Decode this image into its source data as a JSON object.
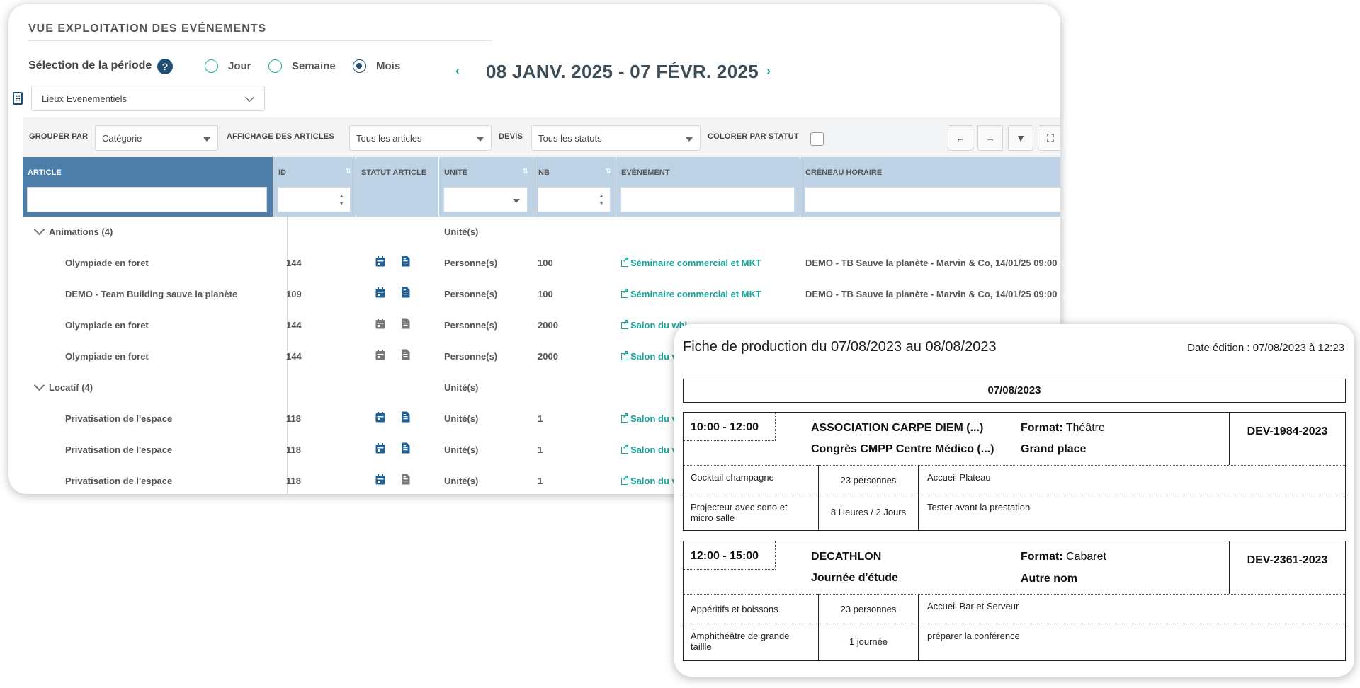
{
  "header": {
    "title": "VUE EXPLOITATION DES EVÉNEMENTS",
    "period_label": "Sélection de la période",
    "help_symbol": "?",
    "period_options": [
      "Jour",
      "Semaine",
      "Mois"
    ],
    "selected_period": "Mois",
    "date_range": "08 JANV. 2025 - 07 FÉVR. 2025",
    "venue": "Lieux Evenementiels"
  },
  "toolbar": {
    "group_by_label": "GROUPER PAR",
    "group_by_value": "Catégorie",
    "display_label": "AFFICHAGE DES ARTICLES",
    "display_value": "Tous les articles",
    "quote_label": "DEVIS",
    "quote_value": "Tous les statuts",
    "color_by_status_label": "COLORER PAR STATUT",
    "color_by_status_checked": false,
    "buttons": [
      "arrow-left-icon",
      "arrow-right-icon",
      "filter-icon",
      "fullscreen-icon"
    ]
  },
  "grid": {
    "columns": [
      "ARTICLE",
      "ID",
      "STATUT ARTICLE",
      "UNITÉ",
      "NB",
      "EVÉNEMENT",
      "CRÉNEAU HORAIRE"
    ],
    "groups": [
      {
        "name": "Animations (4)",
        "unit": "Unité(s)",
        "rows": [
          {
            "article": "Olympiade en foret",
            "id": "144",
            "status": "active",
            "unit": "Personne(s)",
            "nb": "100",
            "event": "Séminaire commercial et MKT",
            "slot": "DEMO - TB Sauve la planète - Marvin & Co, 14/01/25 09:00 -"
          },
          {
            "article": "DEMO - Team Building sauve la planète",
            "id": "109",
            "status": "active",
            "unit": "Personne(s)",
            "nb": "100",
            "event": "Séminaire commercial et MKT",
            "slot": "DEMO - TB Sauve la planète - Marvin & Co, 14/01/25 09:00 -"
          },
          {
            "article": "Olympiade en foret",
            "id": "144",
            "status": "inactive",
            "unit": "Personne(s)",
            "nb": "2000",
            "event": "Salon du whi",
            "slot": ""
          },
          {
            "article": "Olympiade en foret",
            "id": "144",
            "status": "inactive",
            "unit": "Personne(s)",
            "nb": "2000",
            "event": "Salon du v",
            "slot": ""
          }
        ]
      },
      {
        "name": "Locatif (4)",
        "unit": "Unité(s)",
        "rows": [
          {
            "article": "Privatisation de l'espace",
            "id": "118",
            "status": "active",
            "unit": "Unité(s)",
            "nb": "1",
            "event": "Salon du v",
            "slot": ""
          },
          {
            "article": "Privatisation de l'espace",
            "id": "118",
            "status": "active",
            "unit": "Unité(s)",
            "nb": "1",
            "event": "Salon du v",
            "slot": ""
          },
          {
            "article": "Privatisation de l'espace",
            "id": "118",
            "status": "mixed",
            "unit": "Unité(s)",
            "nb": "1",
            "event": "Salon du v",
            "slot": ""
          }
        ]
      }
    ]
  },
  "production_sheet": {
    "title": "Fiche de production du 07/08/2023 au 08/08/2023",
    "edition": "Date édition : 07/08/2023 à 12:23",
    "day": "07/08/2023",
    "bookings": [
      {
        "time": "10:00 - 12:00",
        "client": "ASSOCIATION CARPE DIEM (...)",
        "event": "Congrès CMPP Centre Médico (...)",
        "format_label": "Format:",
        "format_value": "Théâtre",
        "room": "Grand place",
        "ref": "DEV-1984-2023",
        "items": [
          {
            "name": "Cocktail champagne",
            "qty": "23 personnes",
            "note": "Accueil Plateau"
          },
          {
            "name": "Projecteur avec sono et micro salle",
            "qty": "8 Heures / 2 Jours",
            "note": "Tester avant la prestation"
          }
        ]
      },
      {
        "time": "12:00 - 15:00",
        "client": "DECATHLON",
        "event": "Journée d'étude",
        "format_label": "Format:",
        "format_value": "Cabaret",
        "room": "Autre nom",
        "ref": "DEV-2361-2023",
        "items": [
          {
            "name": "Appéritifs et boissons",
            "qty": "23 personnes",
            "note": "Accueil Bar et Serveur"
          },
          {
            "name": "Amphithéâtre de grande taillle",
            "qty": "1 journée",
            "note": "préparer la conférence"
          }
        ]
      }
    ]
  },
  "colors": {
    "accent": "#22a9a2",
    "dark_blue": "#1f4f75",
    "header_blue": "#4d7eaa",
    "header_light": "#bed3e6",
    "icon_active": "#1f5f96",
    "icon_inactive": "#777777"
  }
}
